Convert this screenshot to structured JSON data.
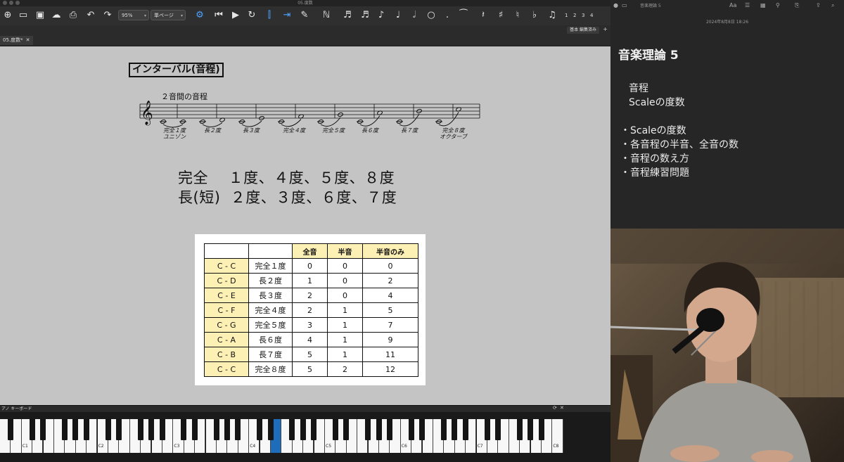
{
  "window": {
    "title": "05.度数"
  },
  "toolbar": {
    "zoom": "95%",
    "view_mode": "単ページ",
    "voice_numbers": [
      "1",
      "2",
      "3",
      "4"
    ]
  },
  "subbar": {
    "view_label": "基本 編集済み",
    "add": "+"
  },
  "tab": {
    "label": "05.度数*",
    "close": "✕"
  },
  "score": {
    "title": "インターバル(音程)",
    "staff_subtitle": "２音間の音程",
    "interval_labels": [
      {
        "line1": "完全１度",
        "line2": "ユニゾン"
      },
      {
        "line1": "長２度",
        "line2": ""
      },
      {
        "line1": "長３度",
        "line2": ""
      },
      {
        "line1": "完全４度",
        "line2": ""
      },
      {
        "line1": "完全５度",
        "line2": ""
      },
      {
        "line1": "長６度",
        "line2": ""
      },
      {
        "line1": "長７度",
        "line2": ""
      },
      {
        "line1": "完全８度",
        "line2": "オクターブ"
      }
    ],
    "perfect_line": "完全　 １度、４度、５度、８度",
    "major_line": "長(短)  ２度、３度、６度、７度",
    "table": {
      "headers": [
        "",
        "",
        "全音",
        "半音",
        "半音のみ"
      ],
      "rows": [
        [
          "C - C",
          "完全１度",
          "0",
          "0",
          "0"
        ],
        [
          "C - D",
          "長２度",
          "1",
          "0",
          "2"
        ],
        [
          "C - E",
          "長３度",
          "2",
          "0",
          "4"
        ],
        [
          "C - F",
          "完全４度",
          "2",
          "1",
          "5"
        ],
        [
          "C - G",
          "完全５度",
          "3",
          "1",
          "7"
        ],
        [
          "C - A",
          "長６度",
          "4",
          "1",
          "9"
        ],
        [
          "C - B",
          "長７度",
          "5",
          "1",
          "11"
        ],
        [
          "C - C",
          "完全８度",
          "5",
          "2",
          "12"
        ]
      ]
    }
  },
  "piano": {
    "header": "アノ キーボード",
    "octave_labels": [
      "C1",
      "C2",
      "C3",
      "C4",
      "C5",
      "C6",
      "C7",
      "C8"
    ],
    "highlight_color": "#1e6dbb"
  },
  "notes": {
    "window_title": "音楽理論 5",
    "date": "2024年8月8日 18:26",
    "title": "音楽理論 5",
    "lines": [
      "音程",
      "Scaleの度数"
    ],
    "bullets": [
      "Scaleの度数",
      "各音程の半音、全音の数",
      "音程の数え方",
      "音程練習問題"
    ]
  },
  "colors": {
    "table_key_bg": "#fdf0b4",
    "score_bg": "#c4c4c4",
    "accent": "#2a8ad4"
  }
}
